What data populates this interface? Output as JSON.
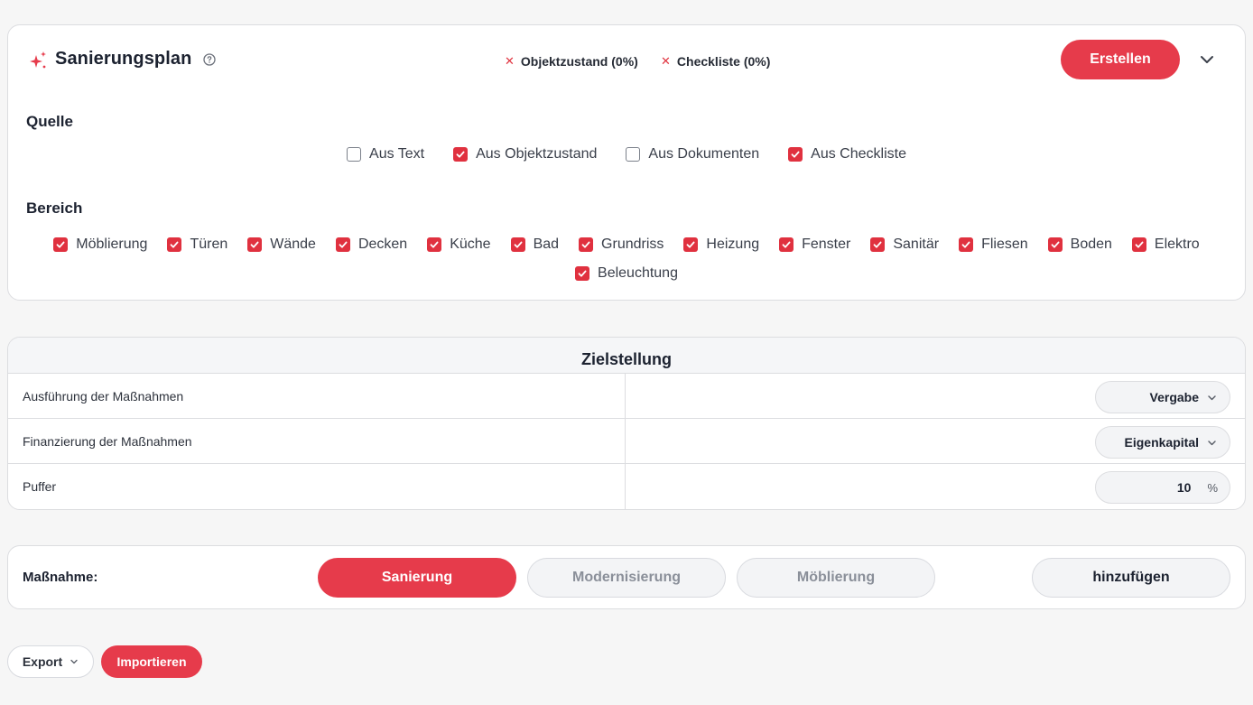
{
  "plan": {
    "title": "Sanierungsplan",
    "statuses": [
      {
        "label": "Objektzustand (0%)"
      },
      {
        "label": "Checkliste (0%)"
      }
    ],
    "create_button": "Erstellen"
  },
  "quelle": {
    "label": "Quelle",
    "options": [
      {
        "label": "Aus Text",
        "checked": false
      },
      {
        "label": "Aus Objektzustand",
        "checked": true
      },
      {
        "label": "Aus Dokumenten",
        "checked": false
      },
      {
        "label": "Aus Checkliste",
        "checked": true
      }
    ]
  },
  "bereich": {
    "label": "Bereich",
    "options": [
      {
        "label": "Möblierung",
        "checked": true
      },
      {
        "label": "Türen",
        "checked": true
      },
      {
        "label": "Wände",
        "checked": true
      },
      {
        "label": "Decken",
        "checked": true
      },
      {
        "label": "Küche",
        "checked": true
      },
      {
        "label": "Bad",
        "checked": true
      },
      {
        "label": "Grundriss",
        "checked": true
      },
      {
        "label": "Heizung",
        "checked": true
      },
      {
        "label": "Fenster",
        "checked": true
      },
      {
        "label": "Sanitär",
        "checked": true
      },
      {
        "label": "Fliesen",
        "checked": true
      },
      {
        "label": "Boden",
        "checked": true
      },
      {
        "label": "Elektro",
        "checked": true
      },
      {
        "label": "Beleuchtung",
        "checked": true
      }
    ]
  },
  "ziel": {
    "title": "Zielstellung",
    "rows": [
      {
        "label": "Ausführung der Maßnahmen",
        "value": "Vergabe"
      },
      {
        "label": "Finanzierung der Maßnahmen",
        "value": "Eigenkapital"
      },
      {
        "label": "Puffer",
        "value": "10",
        "unit": "%"
      }
    ]
  },
  "massnahme": {
    "label": "Maßnahme:",
    "tabs": [
      "Sanierung",
      "Modernisierung",
      "Möblierung"
    ],
    "active_tab": 0,
    "add_button": "hinzufügen"
  },
  "footer": {
    "export": "Export",
    "import": "Importieren"
  },
  "colors": {
    "accent": "#e63b4b",
    "checkbox": "#e0313f"
  },
  "icons": [
    "sparkle-icon",
    "help-circle-icon",
    "close-x-icon",
    "chevron-down-icon",
    "checkmark-icon"
  ]
}
